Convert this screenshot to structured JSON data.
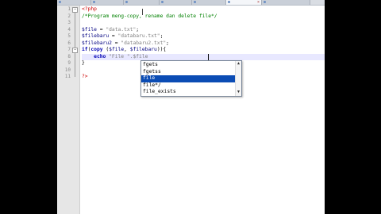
{
  "tabs": [
    {
      "active": false
    },
    {
      "active": false
    },
    {
      "active": false
    },
    {
      "active": false
    },
    {
      "active": false
    },
    {
      "active": true
    },
    {
      "active": false
    }
  ],
  "lines": [
    "1",
    "2",
    "3",
    "4",
    "5",
    "6",
    "7",
    "8",
    "9",
    "10",
    "11"
  ],
  "code": {
    "l1": "<?php",
    "l2": "/*Program meng-copy, rename dan delete file*/",
    "l4_var": "$file",
    "l4_op": " = ",
    "l4_str": "\"data.txt\"",
    "l4_end": ";",
    "l5_var": "$filebaru",
    "l5_op": " = ",
    "l5_str": "\"databaru.txt\"",
    "l5_end": ";",
    "l6_var": "$filebaru2",
    "l6_op": " = ",
    "l6_str": "\"databaru2.txt\"",
    "l6_end": ";",
    "l7_kw": "if",
    "l7_a": "(",
    "l7_fn": "copy",
    "l7_b": " (",
    "l7_v1": "$file",
    "l7_c": ", ",
    "l7_v2": "$filebaru",
    "l7_d": ")){",
    "l8_indent": "    ",
    "l8_kw": "echo",
    "l8_str": " \"File \".$file",
    "l9": "}",
    "l11": "?>"
  },
  "autocomplete": {
    "items": [
      "fgets",
      "fgetss",
      "file",
      "file*/",
      "file_exists"
    ],
    "selected_index": 2
  }
}
